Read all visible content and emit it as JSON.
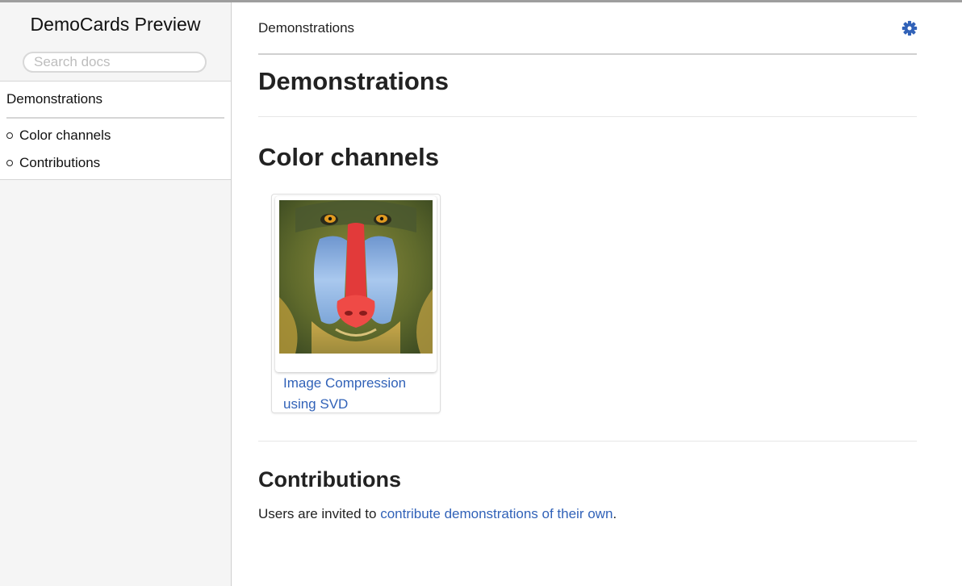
{
  "sidebar": {
    "site_title": "DemoCards Preview",
    "search_placeholder": "Search docs",
    "current_page": "Demonstrations",
    "items": [
      {
        "label": "Color channels"
      },
      {
        "label": "Contributions"
      }
    ]
  },
  "header": {
    "breadcrumb": "Demonstrations",
    "settings_icon": "gear-icon",
    "accent_color": "#3162b8"
  },
  "main": {
    "title": "Demonstrations",
    "sections": [
      {
        "heading": "Color channels",
        "cards": [
          {
            "title": "Image Compression using SVD",
            "thumbnail": "mandrill-image"
          }
        ]
      },
      {
        "heading": "Contributions",
        "text_before": "Users are invited to ",
        "link_text": "contribute demonstrations of their own",
        "text_after": "."
      }
    ]
  }
}
